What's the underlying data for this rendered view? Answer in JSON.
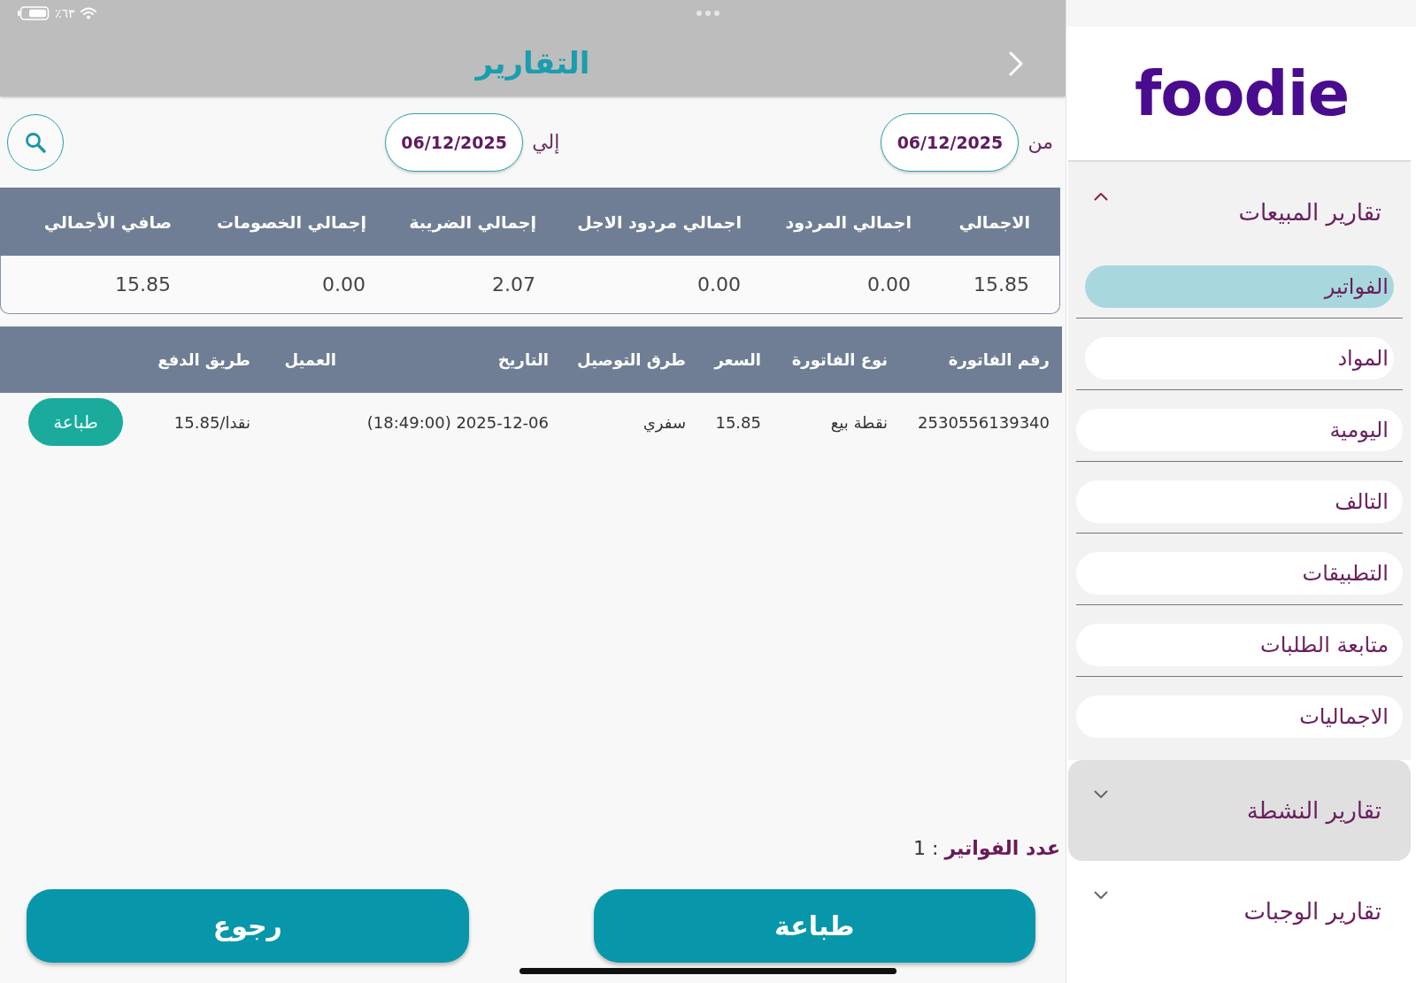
{
  "status_bar": {
    "battery": "٦٣٪"
  },
  "header": {
    "title": "التقارير"
  },
  "date_filter": {
    "from_label": "من",
    "from_date": "06/12/2025",
    "to_label": "إلي",
    "to_date": "06/12/2025"
  },
  "summary_table": {
    "columns": [
      "الاجمالي",
      "اجمالي المردود",
      "اجمالي مردود الاجل",
      "إجمالي الضريبة",
      "إجمالي الخصومات",
      "صافي الأجمالي"
    ],
    "rows": [
      [
        "15.85",
        "0.00",
        "0.00",
        "2.07",
        "0.00",
        "15.85"
      ]
    ]
  },
  "invoice_table": {
    "columns": [
      "رقم الفاتورة",
      "نوع الفاتورة",
      "السعر",
      "طرق التوصيل",
      "التاريخ",
      "العميل",
      "طريق الدفع"
    ],
    "rows": [
      {
        "invoice_number": "2530556139340",
        "invoice_type": "نقطة بيع",
        "price": "15.85",
        "delivery_method": "سفري",
        "date": "2025-12-06 (18:49:00)",
        "payment": "نقدا/15.85",
        "print_button": "طباعة"
      }
    ]
  },
  "invoice_count": "**عدد الفواتير** : 1",
  "footer_buttons": [
    "طباعة",
    "رجوع"
  ],
  "sidebar": {
    "logo": "foodie",
    "sections": [
      {
        "title": "تقارير المبيعات",
        "expanded": true,
        "highlighted": false,
        "items": [
          {
            "label": "الفواتير",
            "selected": true
          },
          {
            "label": "المواد",
            "selected": false
          },
          {
            "label": "اليومية",
            "selected": false
          },
          {
            "label": "التالف",
            "selected": false
          },
          {
            "label": "التطبيقات",
            "selected": false
          },
          {
            "label": "متابعة الطلبات",
            "selected": false
          },
          {
            "label": "الاجماليات",
            "selected": false
          }
        ]
      },
      {
        "title": "تقارير النشطة",
        "expanded": false,
        "highlighted": true
      },
      {
        "title": "تقارير الوجبات",
        "expanded": false,
        "highlighted": false
      }
    ]
  }
}
